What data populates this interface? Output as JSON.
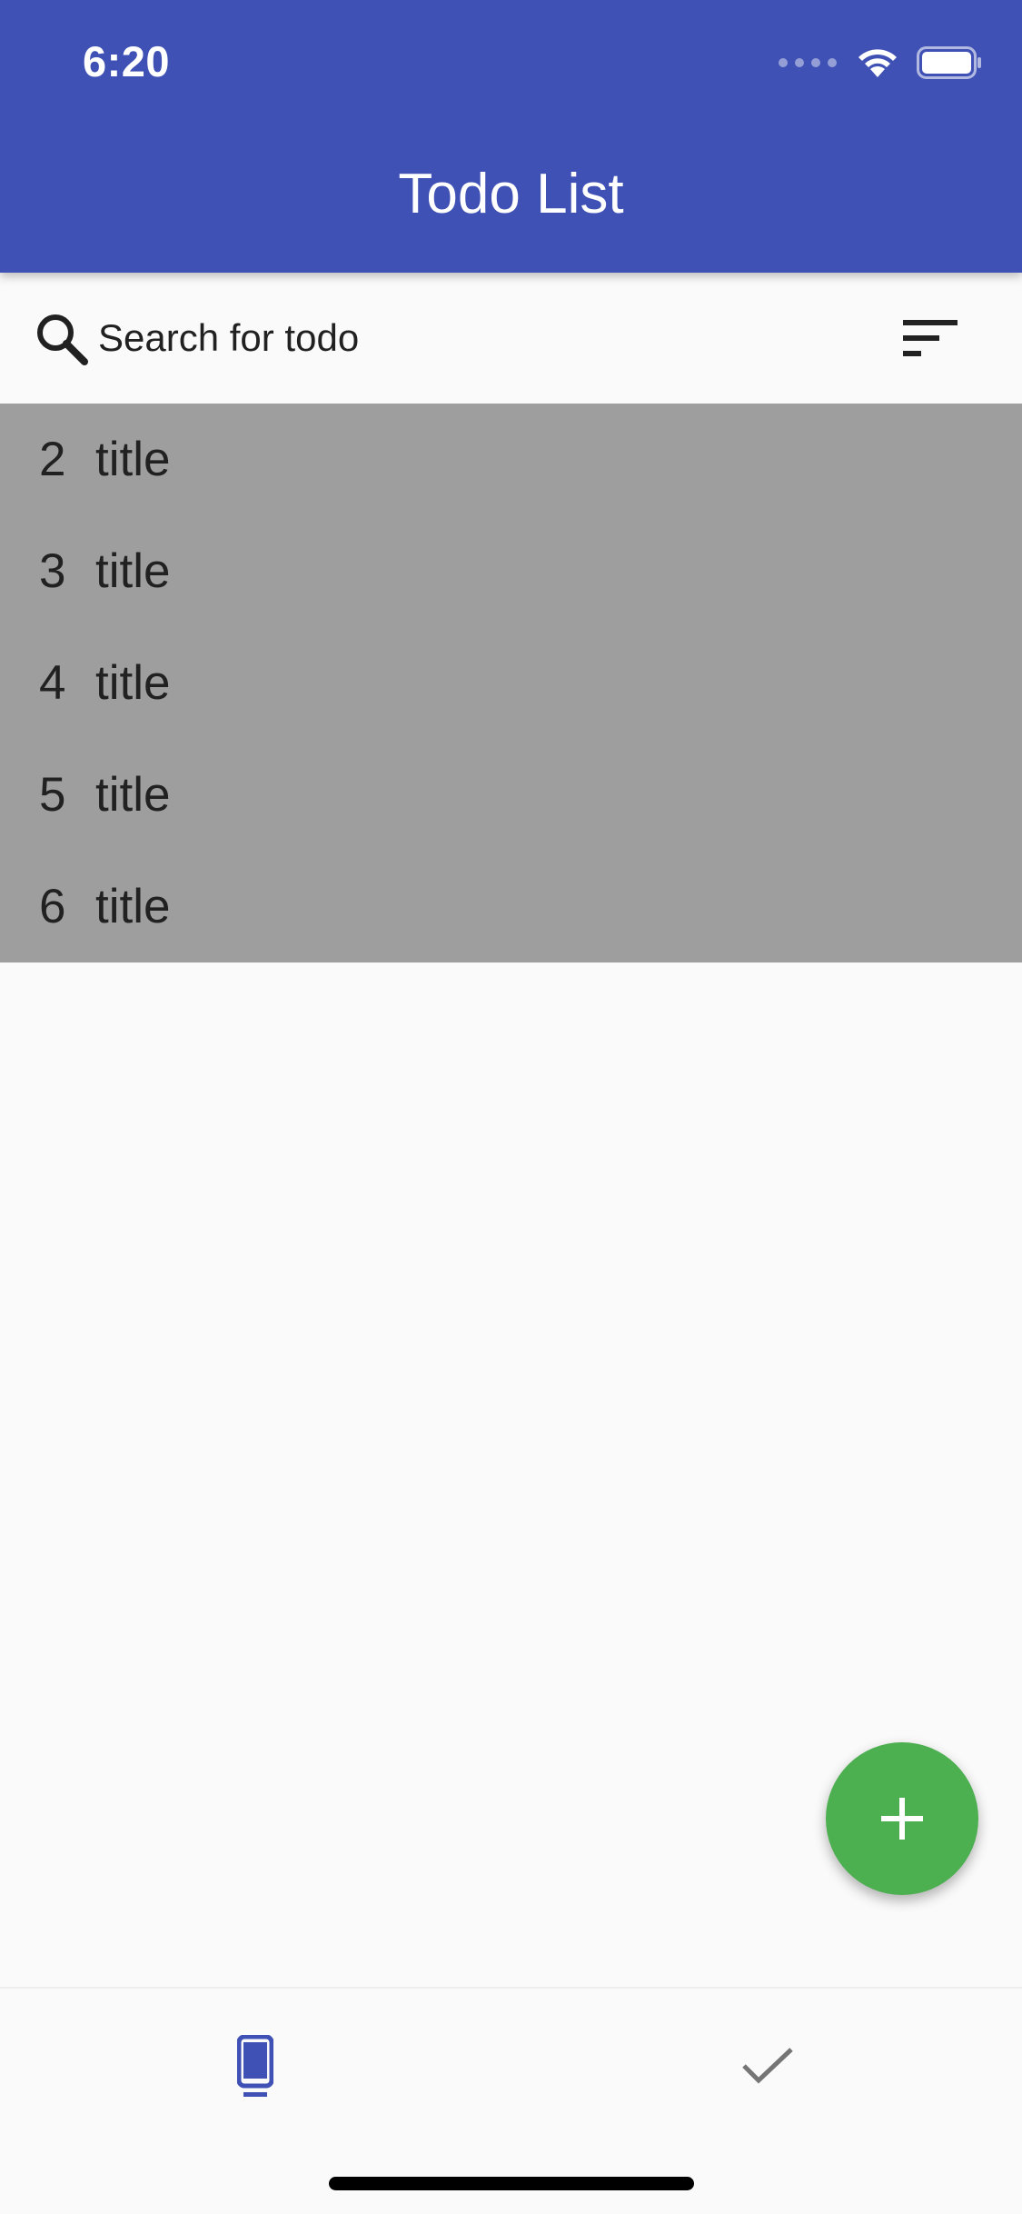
{
  "status_bar": {
    "time": "6:20"
  },
  "app_bar": {
    "title": "Todo List",
    "color": "#3f51b5"
  },
  "search": {
    "placeholder": "Search for todo",
    "value": ""
  },
  "todos": [
    {
      "number": "2",
      "title": "title"
    },
    {
      "number": "3",
      "title": "title"
    },
    {
      "number": "4",
      "title": "title"
    },
    {
      "number": "5",
      "title": "title"
    },
    {
      "number": "6",
      "title": "title"
    }
  ],
  "fab": {
    "icon": "plus-icon",
    "color": "#4caf50"
  },
  "bottom_nav": {
    "tabs": [
      {
        "icon": "phone-icon",
        "active": true,
        "color": "#3f51b5"
      },
      {
        "icon": "check-icon",
        "active": false,
        "color": "#757575"
      }
    ]
  },
  "colors": {
    "list_background": "#9e9e9e",
    "page_background": "#fafafa"
  }
}
